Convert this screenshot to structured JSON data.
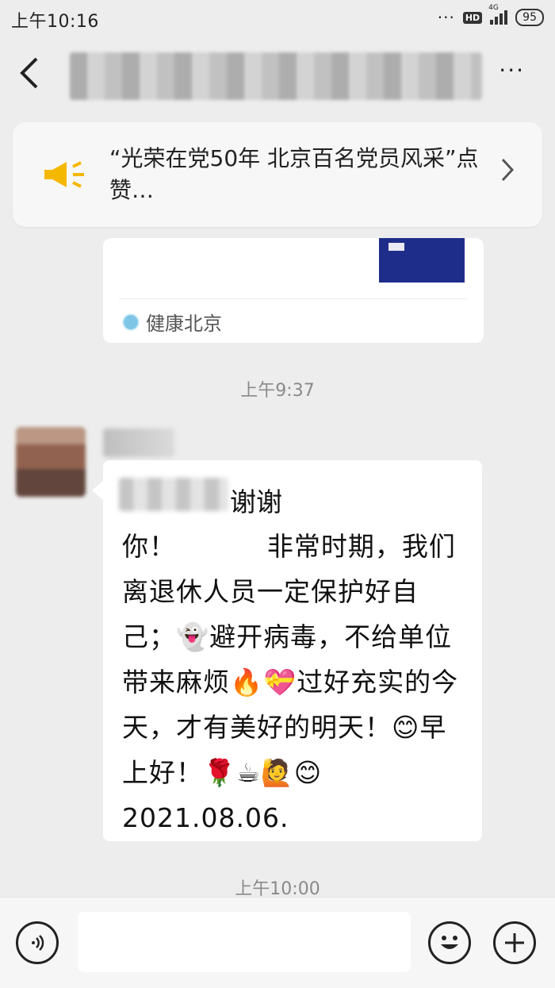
{
  "status_bar": {
    "time": "上午10:16",
    "dots": "···",
    "hd": "HD",
    "network": "4G",
    "battery": "95"
  },
  "header": {
    "back_icon": "chevron-left-icon",
    "more_label": "···"
  },
  "notice": {
    "icon": "megaphone-icon",
    "text": "“光荣在党50年 北京百名党员风采”点赞…",
    "accent": "#f5b800"
  },
  "link_card": {
    "source": "健康北京"
  },
  "timestamps": {
    "t1": "上午9:37",
    "t2": "上午10:00"
  },
  "message": {
    "first_line": "谢谢",
    "body": "你！          非常时期，我们离退休人员一定保护好自己；👻避开病毒，不给单位带来麻烦🔥💝过好充实的今天，才有美好的明天！😊早上好！🌹☕🙋😊2021.08.06."
  },
  "input_bar": {
    "voice_icon": "voice-icon",
    "emoji_icon": "smile-icon",
    "plus_icon": "plus-icon"
  }
}
